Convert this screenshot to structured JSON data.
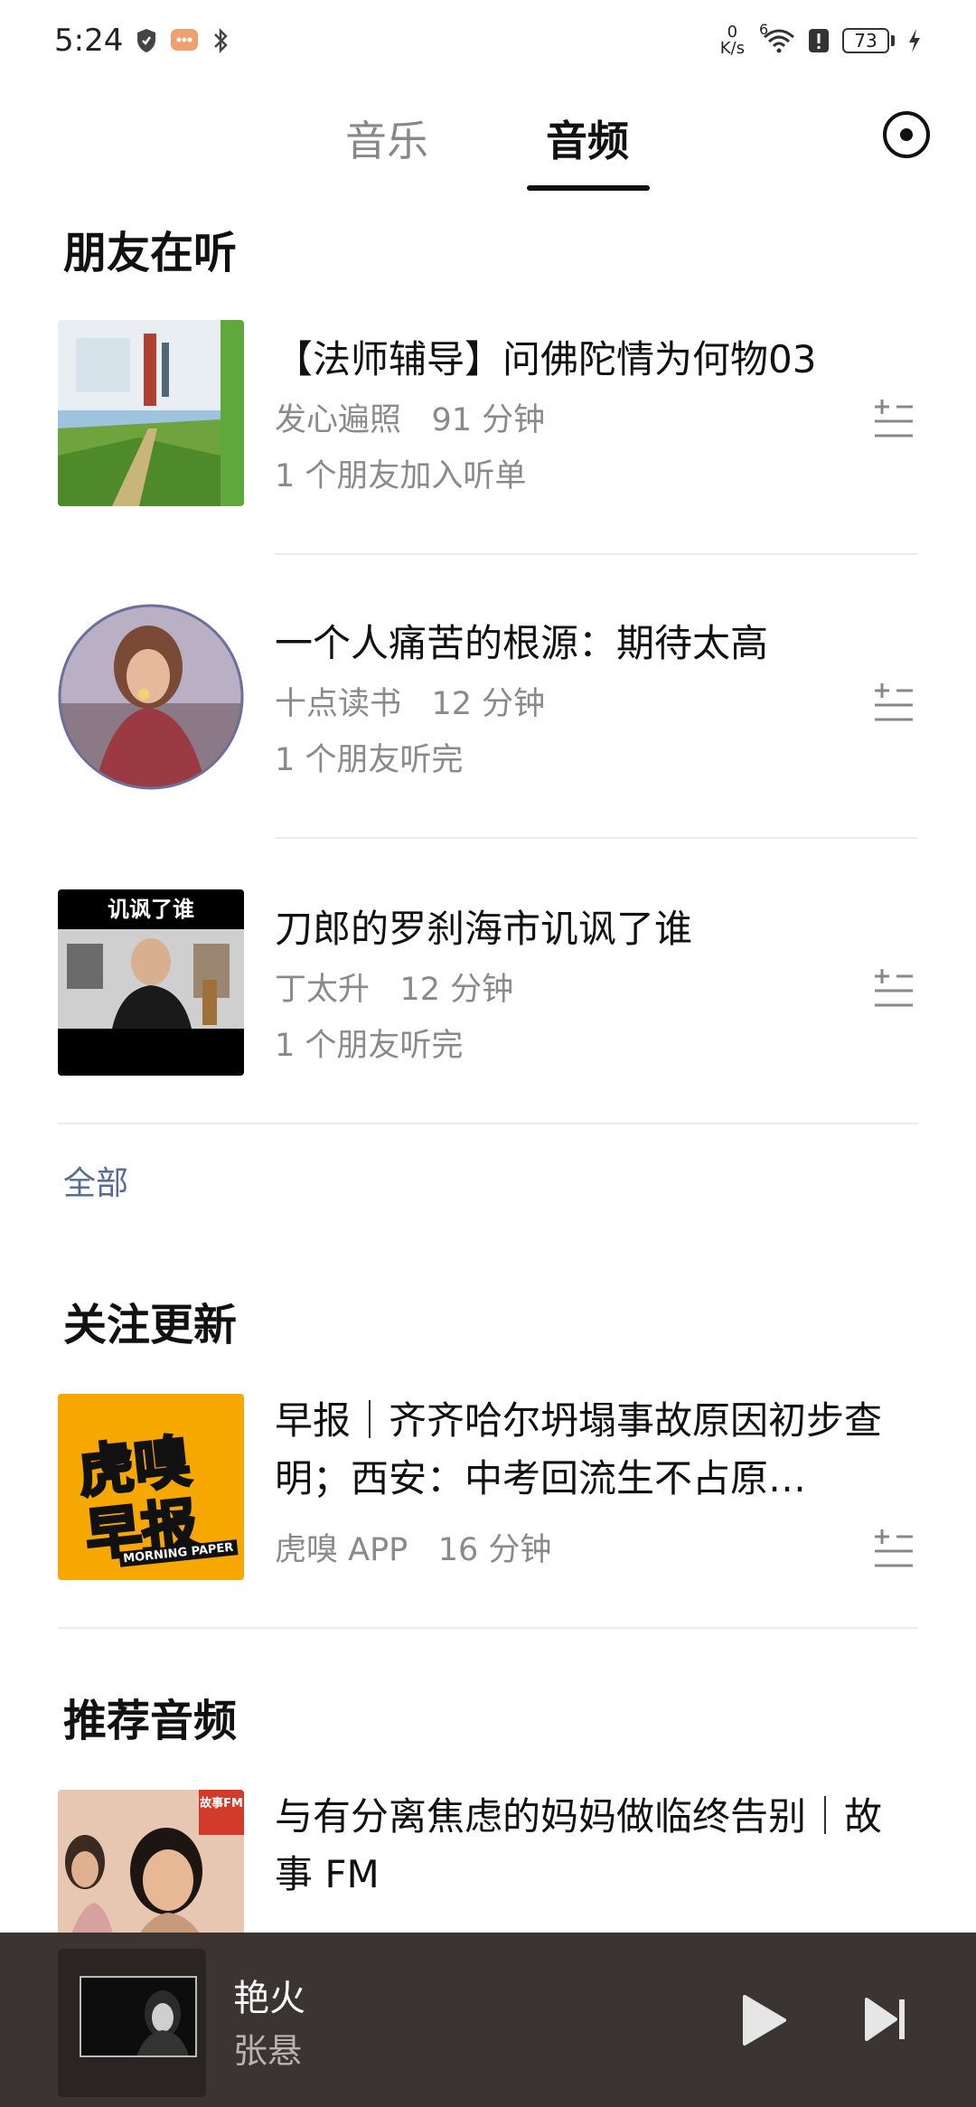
{
  "status_bar": {
    "time": "5:24",
    "net_speed_value": "0",
    "net_speed_unit": "K/s",
    "wifi_gen": "6",
    "battery": "73",
    "icons": [
      "shield-icon",
      "message-bubble-icon",
      "bluetooth-icon",
      "wifi-icon",
      "alert-icon",
      "battery-icon",
      "charging-icon"
    ]
  },
  "tabs": {
    "music": "音乐",
    "audio": "音频",
    "active": "audio"
  },
  "friends_section": {
    "title": "朋友在听",
    "items": [
      {
        "title": "【法师辅导】问佛陀情为何物03",
        "author": "发心遍照",
        "duration": "91 分钟",
        "friend_note": "1 个朋友加入听单"
      },
      {
        "title": "一个人痛苦的根源：期待太高",
        "author": "十点读书",
        "duration": "12 分钟",
        "friend_note": "1 个朋友听完"
      },
      {
        "title": "刀郎的罗刹海市讥讽了谁",
        "author": "丁太升",
        "duration": "12 分钟",
        "friend_note": "1 个朋友听完",
        "cover_caption": "讥讽了谁"
      }
    ],
    "all_link": "全部"
  },
  "follow_section": {
    "title": "关注更新",
    "items": [
      {
        "title": "早报｜齐齐哈尔坍塌事故原因初步查明；西安：中考回流生不占原…",
        "author": "虎嗅 APP",
        "duration": "16 分钟",
        "cover_text_1": "虎嗅",
        "cover_text_2": "早报",
        "cover_text_3": "MORNING PAPER"
      }
    ]
  },
  "recommend_section": {
    "title": "推荐音频",
    "items": [
      {
        "title": "与有分离焦虑的妈妈做临终告别｜故事 FM",
        "cover_badge": "故事FM"
      }
    ]
  },
  "player": {
    "title": "艳火",
    "artist": "张悬"
  },
  "colors": {
    "link": "#576b95",
    "player_bg": "#3a3432",
    "accent_yellow": "#f6a800"
  }
}
